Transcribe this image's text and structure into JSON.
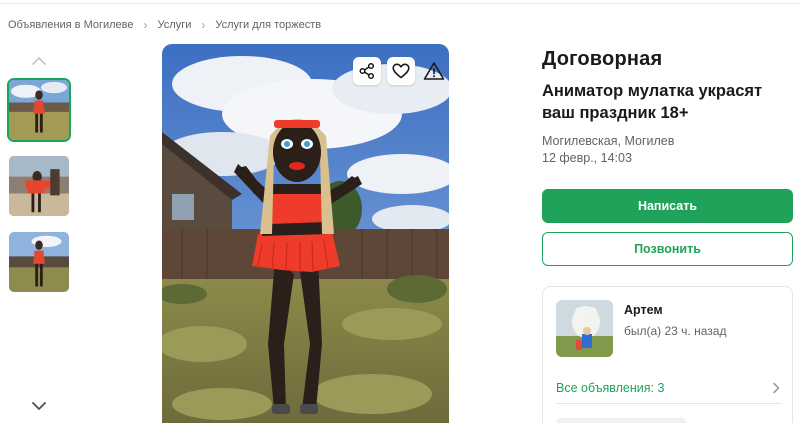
{
  "breadcrumb": {
    "items": [
      "Объявления в Могилеве",
      "Услуги",
      "Услуги для торжеств"
    ],
    "separator": "›"
  },
  "gallery": {
    "up_icon": "chevron-up-icon",
    "down_icon": "chevron-down-icon",
    "thumbnail_count": 3,
    "selected_index": 0
  },
  "photo_actions": {
    "share_icon": "share-icon",
    "favorite_icon": "heart-icon",
    "report_icon": "warning-triangle-icon"
  },
  "listing": {
    "price": "Договорная",
    "title": "Аниматор мулатка украсят ваш праздник 18+",
    "location": "Могилевская, Могилев",
    "date": "12 февр., 14:03"
  },
  "actions": {
    "write_label": "Написать",
    "call_label": "Позвонить"
  },
  "seller": {
    "name": "Артем",
    "last_seen": "был(а) 23 ч. назад",
    "all_ads_label": "Все объявления: 3"
  },
  "colors": {
    "accent": "#1fa35a",
    "text": "#1a1a1a",
    "muted": "#5f6368"
  }
}
